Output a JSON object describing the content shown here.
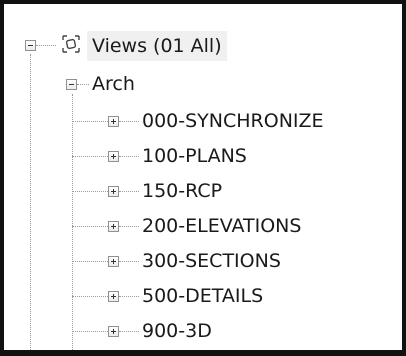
{
  "tree": {
    "root": {
      "label": "Views (01 All)",
      "icon": "views-icon",
      "expanded": true
    },
    "discipline": {
      "label": "Arch",
      "expanded": true
    },
    "groups": [
      {
        "label": "000-SYNCHRONIZE",
        "expanded": false
      },
      {
        "label": "100-PLANS",
        "expanded": false
      },
      {
        "label": "150-RCP",
        "expanded": false
      },
      {
        "label": "200-ELEVATIONS",
        "expanded": false
      },
      {
        "label": "300-SECTIONS",
        "expanded": false
      },
      {
        "label": "500-DETAILS",
        "expanded": false
      },
      {
        "label": "900-3D",
        "expanded": false
      }
    ]
  }
}
